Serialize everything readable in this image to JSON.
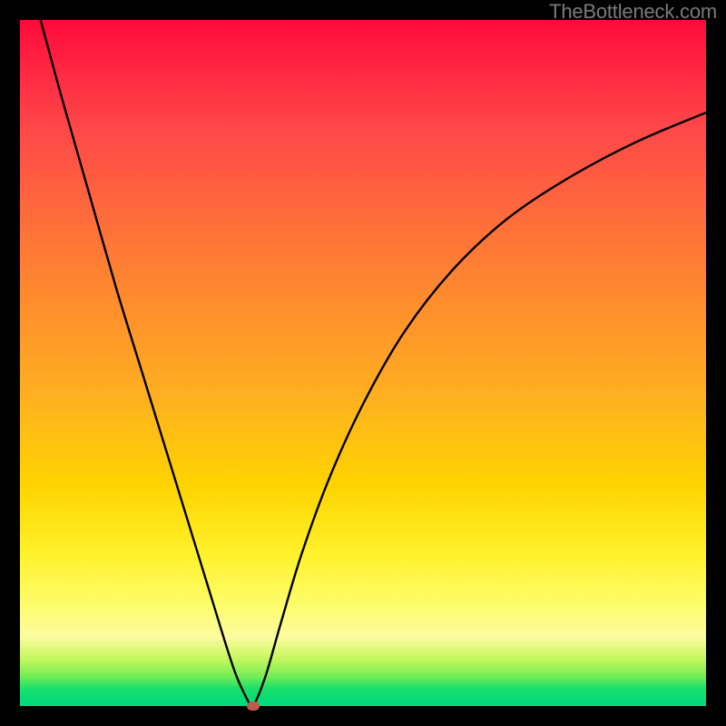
{
  "watermark": "TheBottleneck.com",
  "colors": {
    "background": "#000000",
    "curve": "#000000",
    "marker": "#c05a4a"
  },
  "chart_data": {
    "type": "line",
    "title": "",
    "xlabel": "",
    "ylabel": "",
    "xlim": [
      0,
      100
    ],
    "ylim": [
      0,
      100
    ],
    "grid": false,
    "series": [
      {
        "name": "bottleneck-curve",
        "x": [
          3,
          6,
          10,
          14,
          18,
          22,
          26,
          28,
          30,
          31.5,
          33,
          33.8,
          34.6,
          36,
          38,
          41,
          45,
          50,
          56,
          63,
          71,
          80,
          90,
          100
        ],
        "y": [
          100,
          89,
          75,
          61,
          48,
          35,
          22,
          15.5,
          9,
          4.5,
          1.2,
          0,
          1.2,
          5,
          12,
          22,
          33,
          44,
          54.5,
          63.5,
          71,
          77,
          82.3,
          86.5
        ]
      }
    ],
    "marker": {
      "x": 34,
      "y": 0
    }
  }
}
